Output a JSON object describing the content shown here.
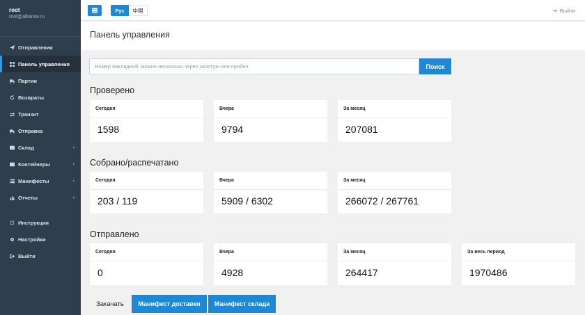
{
  "user": {
    "name": "root",
    "email": "root@alliance.ru"
  },
  "sidebar": {
    "items": [
      {
        "label": "Отправления",
        "icon": "paper-plane-icon"
      },
      {
        "label": "Панель управления",
        "icon": "dashboard-icon"
      },
      {
        "label": "Партии",
        "icon": "truck-icon"
      },
      {
        "label": "Возвраты",
        "icon": "refresh-icon"
      },
      {
        "label": "Транзит",
        "icon": "exchange-icon"
      },
      {
        "label": "Отправка",
        "icon": "truck-icon"
      },
      {
        "label": "Склад",
        "icon": "warehouse-icon"
      },
      {
        "label": "Контейнеры",
        "icon": "container-icon"
      },
      {
        "label": "Манифесты",
        "icon": "list-icon"
      },
      {
        "label": "Отчеты",
        "icon": "chart-icon"
      },
      {
        "label": "Инструкции",
        "icon": "book-icon"
      },
      {
        "label": "Настройки",
        "icon": "gear-icon"
      },
      {
        "label": "Выйти",
        "icon": "sign-out-icon"
      }
    ],
    "chevron": "‹"
  },
  "topbar": {
    "lang_ru": "Рус",
    "lang_cn": "中国",
    "logout": "Выйти"
  },
  "page": {
    "title": "Панель управления"
  },
  "search": {
    "placeholder": "Номер накладной, можно несколько через запятую или пробел",
    "button": "Поиск"
  },
  "sections": {
    "checked": {
      "title": "Проверено",
      "cards": [
        {
          "label": "Сегодня",
          "value": "1598"
        },
        {
          "label": "Вчера",
          "value": "9794"
        },
        {
          "label": "За месяц",
          "value": "207081"
        }
      ]
    },
    "collected": {
      "title": "Собрано/распечатано",
      "cards": [
        {
          "label": "Сегодня",
          "value": "203 / 119"
        },
        {
          "label": "Вчера",
          "value": "5909 / 6302"
        },
        {
          "label": "За месяц",
          "value": "266072 / 267761"
        }
      ]
    },
    "sent": {
      "title": "Отправлено",
      "cards": [
        {
          "label": "Сегодня",
          "value": "0"
        },
        {
          "label": "Вчера",
          "value": "4928"
        },
        {
          "label": "За месяц",
          "value": "264417"
        },
        {
          "label": "За весь период",
          "value": "1970486"
        }
      ]
    }
  },
  "footer": {
    "download_label": "Закачать",
    "delivery_manifest": "Манифест доставки",
    "warehouse_manifest": "Манифест склада"
  },
  "colors": {
    "accent": "#1e88d6",
    "sidebar": "#2f3e4c"
  }
}
